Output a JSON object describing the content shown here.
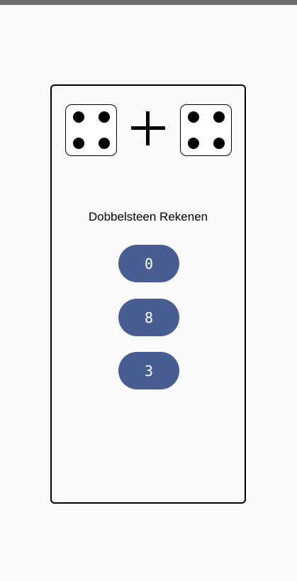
{
  "title": "Dobbelsteen Rekenen",
  "dice": [
    {
      "value": 4,
      "icon": "die-face-four-icon"
    },
    {
      "value": 4,
      "icon": "die-face-four-icon"
    }
  ],
  "operator_icon": "plus-icon",
  "answers": [
    {
      "label": "0"
    },
    {
      "label": "8"
    },
    {
      "label": "3"
    }
  ],
  "colors": {
    "button": "#485e92",
    "button_text": "#ffffff",
    "background": "#fafafa",
    "status_bar": "#6f6f6f"
  }
}
